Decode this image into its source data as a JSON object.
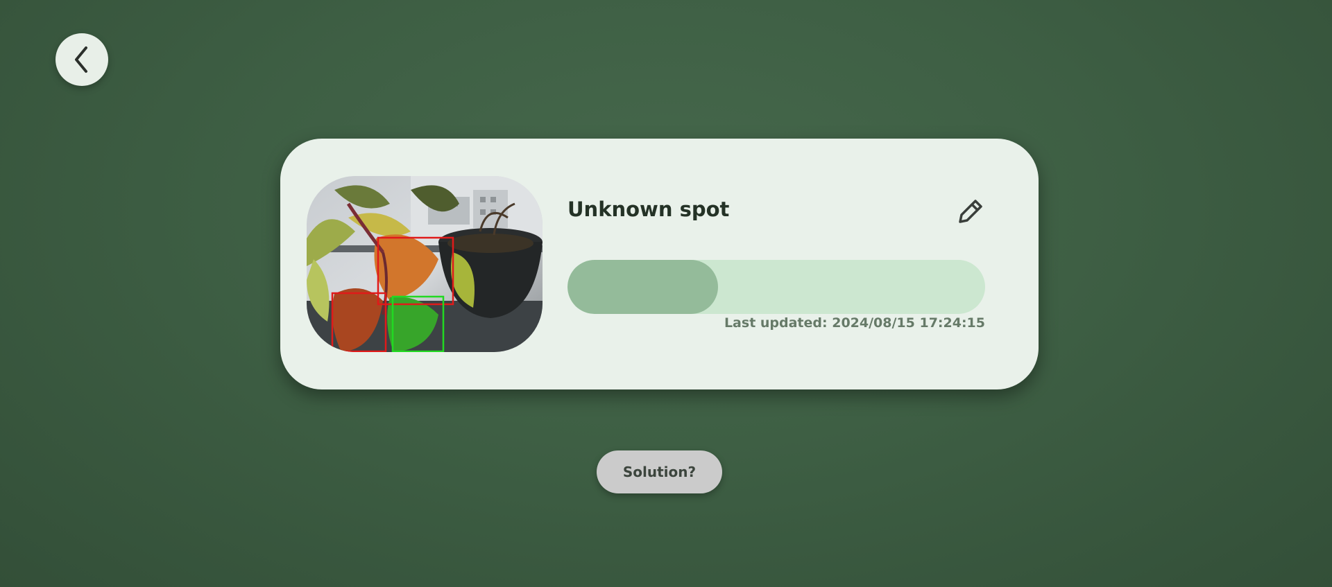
{
  "nav": {
    "back_icon": "chevron-left-icon"
  },
  "plant": {
    "name": "Unknown spot",
    "edit_icon": "pencil-icon",
    "progress_fraction": 0.36,
    "last_updated": "Last updated: 2024/08/15 17:24:15",
    "photo": {
      "detections": [
        {
          "status": "unhealthy",
          "color": "#e01a1a"
        },
        {
          "status": "unhealthy",
          "color": "#e01a1a"
        },
        {
          "status": "healthy",
          "color": "#22d922"
        }
      ]
    }
  },
  "actions": {
    "solution_label": "Solution?"
  },
  "colors": {
    "background": "#3e5f44",
    "card": "#e9f1ea",
    "progress_track": "#cce7d0",
    "progress_fill": "#94bb9a",
    "unhealthy_box": "#e01a1a",
    "healthy_box": "#22d922"
  }
}
